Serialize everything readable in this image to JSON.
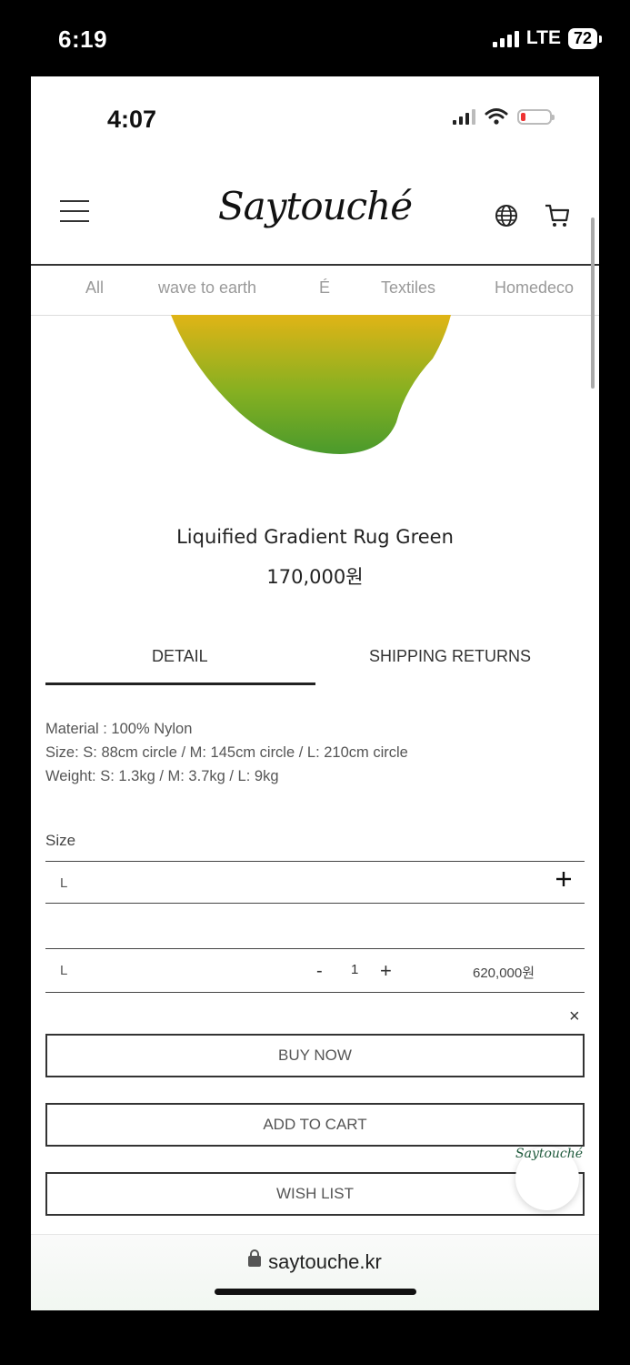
{
  "device": {
    "time": "6:19",
    "network": "LTE",
    "battery": "72"
  },
  "inner_status": {
    "time": "4:07"
  },
  "header": {
    "logo": "Saytouché",
    "menu_icon": "hamburger-menu-icon",
    "globe_icon": "globe-icon",
    "cart_icon": "cart-icon"
  },
  "categories": [
    "All",
    "wave to earth",
    "É",
    "Textiles",
    "Homedeco"
  ],
  "product": {
    "name": "Liquified Gradient Rug Green",
    "price": "170,000원",
    "image_colors": {
      "top": "#e0b416",
      "bottom": "#4a9a2c"
    }
  },
  "tabs": [
    {
      "label": "DETAIL",
      "active": true
    },
    {
      "label": "SHIPPING RETURNS",
      "active": false
    }
  ],
  "detail": {
    "material": "Material : 100% Nylon",
    "size": "Size: S: 88cm circle / M: 145cm circle / L: 210cm circle",
    "weight": "Weight: S: 1.3kg / M: 3.7kg / L: 9kg"
  },
  "options": {
    "size_label": "Size",
    "selected_size": "L",
    "selected_item": {
      "name": "L",
      "quantity": "1",
      "minus": "-",
      "plus": "+",
      "price": "620,000원"
    },
    "remove": "×"
  },
  "buttons": {
    "buy_now": "BUY NOW",
    "add_to_cart": "ADD TO CART",
    "wish_list": "WISH LIST"
  },
  "floating_logo": "Saytouché",
  "browser": {
    "url": "saytouche.kr"
  }
}
